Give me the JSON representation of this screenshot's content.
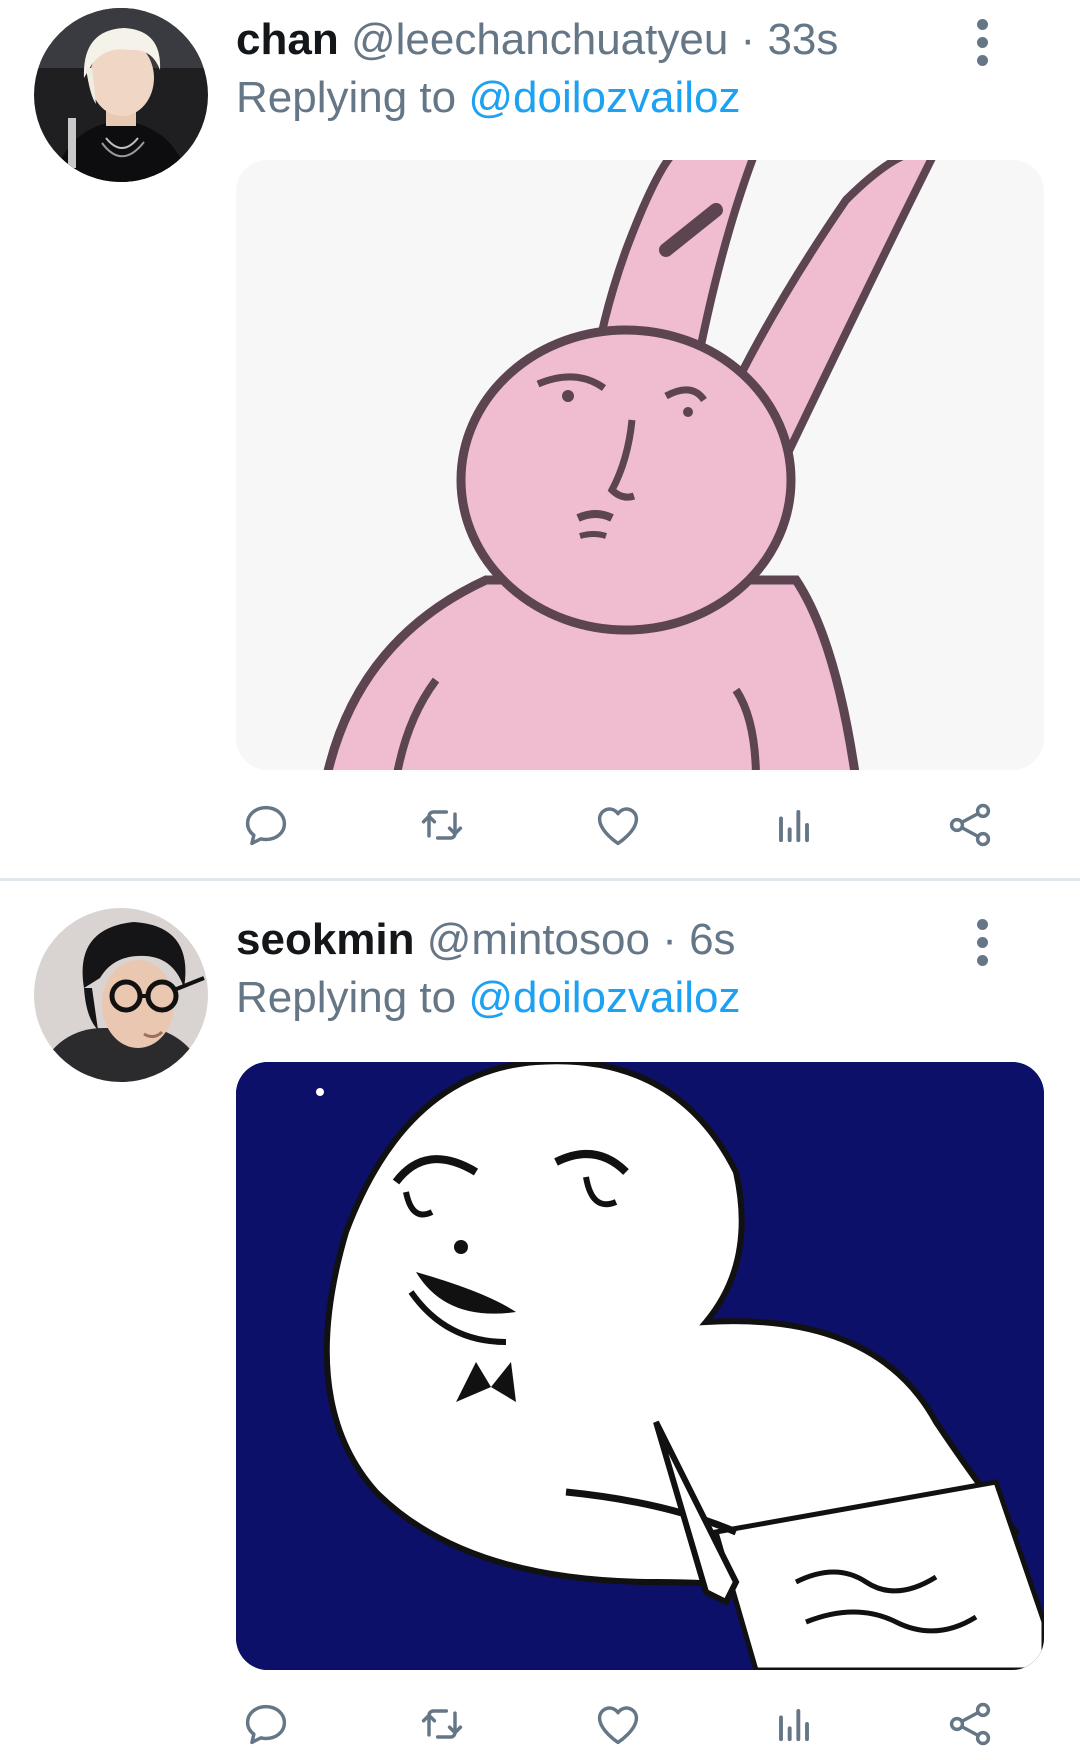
{
  "tweets": [
    {
      "name": "chan",
      "handle": "@leechanchuatyeu",
      "separator": "·",
      "time": "33s",
      "replying_prefix": "Replying to",
      "replying_to": "@doilozvailoz",
      "image_subject": "pink bunny drawing"
    },
    {
      "name": "seokmin",
      "handle": "@mintosoo",
      "separator": "·",
      "time": "6s",
      "replying_prefix": "Replying to",
      "replying_to": "@doilozvailoz",
      "image_subject": "white cartoon writing on paper"
    }
  ],
  "actions": [
    "reply-icon",
    "retweet-icon",
    "like-icon",
    "stats-icon",
    "share-icon"
  ],
  "colors": {
    "text": "#14171a",
    "muted": "#657786",
    "link": "#1da1f2",
    "divider": "#e1e8ed",
    "bunny_pink": "#f0bcd0",
    "navy": "#0c1068"
  }
}
